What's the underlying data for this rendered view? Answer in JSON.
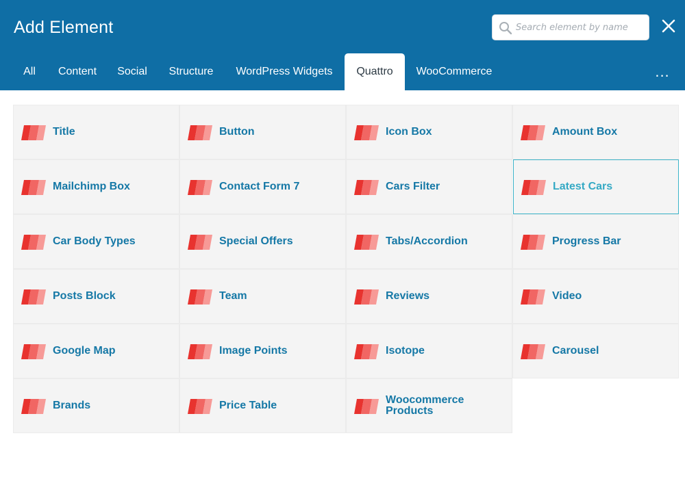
{
  "header": {
    "title": "Add Element",
    "search_placeholder": "Search element by name",
    "close_icon": "close-icon"
  },
  "tabs": [
    {
      "label": "All",
      "active": false
    },
    {
      "label": "Content",
      "active": false
    },
    {
      "label": "Social",
      "active": false
    },
    {
      "label": "Structure",
      "active": false
    },
    {
      "label": "WordPress Widgets",
      "active": false
    },
    {
      "label": "Quattro",
      "active": true
    },
    {
      "label": "WooCommerce",
      "active": false
    }
  ],
  "more_label": "...",
  "elements": [
    {
      "label": "Title",
      "icon": "element-icon"
    },
    {
      "label": "Button",
      "icon": "element-icon"
    },
    {
      "label": "Icon Box",
      "icon": "element-icon"
    },
    {
      "label": "Amount Box",
      "icon": "element-icon"
    },
    {
      "label": "Mailchimp Box",
      "icon": "element-icon"
    },
    {
      "label": "Contact Form 7",
      "icon": "element-icon"
    },
    {
      "label": "Cars Filter",
      "icon": "element-icon"
    },
    {
      "label": "Latest Cars",
      "icon": "element-icon",
      "selected": true
    },
    {
      "label": "Car Body Types",
      "icon": "element-icon"
    },
    {
      "label": "Special Offers",
      "icon": "element-icon"
    },
    {
      "label": "Tabs/Accordion",
      "icon": "element-icon"
    },
    {
      "label": "Progress Bar",
      "icon": "element-icon"
    },
    {
      "label": "Posts Block",
      "icon": "element-icon"
    },
    {
      "label": "Team",
      "icon": "element-icon"
    },
    {
      "label": "Reviews",
      "icon": "element-icon"
    },
    {
      "label": "Video",
      "icon": "element-icon"
    },
    {
      "label": "Google Map",
      "icon": "element-icon"
    },
    {
      "label": "Image Points",
      "icon": "element-icon"
    },
    {
      "label": "Isotope",
      "icon": "element-icon"
    },
    {
      "label": "Carousel",
      "icon": "element-icon"
    },
    {
      "label": "Brands",
      "icon": "element-icon"
    },
    {
      "label": "Price Table",
      "icon": "element-icon"
    },
    {
      "label": "Woocommerce Products",
      "icon": "element-icon"
    }
  ],
  "colors": {
    "header_bg": "#0f6ea5",
    "label_blue": "#1578a6",
    "selected_border": "#3bb3c8",
    "icon_red": "#e8332f"
  }
}
